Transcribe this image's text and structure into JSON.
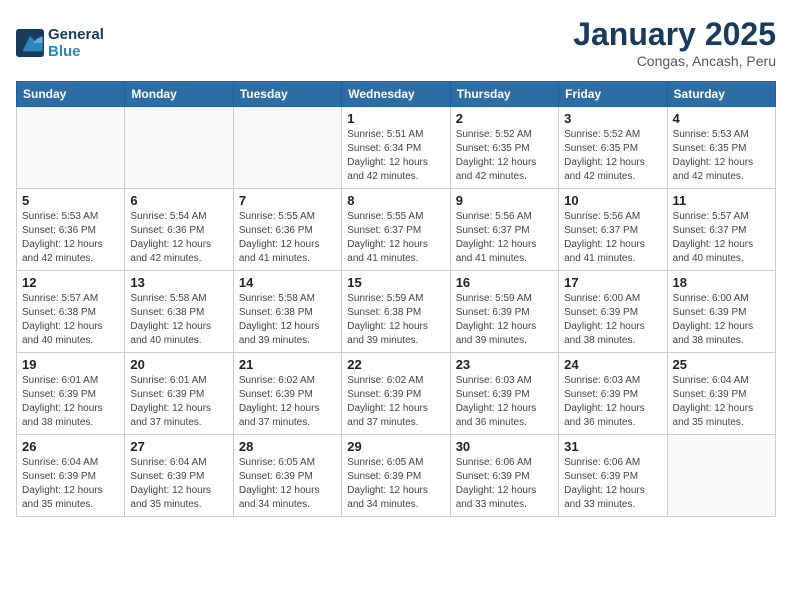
{
  "header": {
    "logo_line1": "General",
    "logo_line2": "Blue",
    "title": "January 2025",
    "subtitle": "Congas, Ancash, Peru"
  },
  "weekdays": [
    "Sunday",
    "Monday",
    "Tuesday",
    "Wednesday",
    "Thursday",
    "Friday",
    "Saturday"
  ],
  "weeks": [
    [
      {
        "day": "",
        "info": ""
      },
      {
        "day": "",
        "info": ""
      },
      {
        "day": "",
        "info": ""
      },
      {
        "day": "1",
        "info": "Sunrise: 5:51 AM\nSunset: 6:34 PM\nDaylight: 12 hours\nand 42 minutes."
      },
      {
        "day": "2",
        "info": "Sunrise: 5:52 AM\nSunset: 6:35 PM\nDaylight: 12 hours\nand 42 minutes."
      },
      {
        "day": "3",
        "info": "Sunrise: 5:52 AM\nSunset: 6:35 PM\nDaylight: 12 hours\nand 42 minutes."
      },
      {
        "day": "4",
        "info": "Sunrise: 5:53 AM\nSunset: 6:35 PM\nDaylight: 12 hours\nand 42 minutes."
      }
    ],
    [
      {
        "day": "5",
        "info": "Sunrise: 5:53 AM\nSunset: 6:36 PM\nDaylight: 12 hours\nand 42 minutes."
      },
      {
        "day": "6",
        "info": "Sunrise: 5:54 AM\nSunset: 6:36 PM\nDaylight: 12 hours\nand 42 minutes."
      },
      {
        "day": "7",
        "info": "Sunrise: 5:55 AM\nSunset: 6:36 PM\nDaylight: 12 hours\nand 41 minutes."
      },
      {
        "day": "8",
        "info": "Sunrise: 5:55 AM\nSunset: 6:37 PM\nDaylight: 12 hours\nand 41 minutes."
      },
      {
        "day": "9",
        "info": "Sunrise: 5:56 AM\nSunset: 6:37 PM\nDaylight: 12 hours\nand 41 minutes."
      },
      {
        "day": "10",
        "info": "Sunrise: 5:56 AM\nSunset: 6:37 PM\nDaylight: 12 hours\nand 41 minutes."
      },
      {
        "day": "11",
        "info": "Sunrise: 5:57 AM\nSunset: 6:37 PM\nDaylight: 12 hours\nand 40 minutes."
      }
    ],
    [
      {
        "day": "12",
        "info": "Sunrise: 5:57 AM\nSunset: 6:38 PM\nDaylight: 12 hours\nand 40 minutes."
      },
      {
        "day": "13",
        "info": "Sunrise: 5:58 AM\nSunset: 6:38 PM\nDaylight: 12 hours\nand 40 minutes."
      },
      {
        "day": "14",
        "info": "Sunrise: 5:58 AM\nSunset: 6:38 PM\nDaylight: 12 hours\nand 39 minutes."
      },
      {
        "day": "15",
        "info": "Sunrise: 5:59 AM\nSunset: 6:38 PM\nDaylight: 12 hours\nand 39 minutes."
      },
      {
        "day": "16",
        "info": "Sunrise: 5:59 AM\nSunset: 6:39 PM\nDaylight: 12 hours\nand 39 minutes."
      },
      {
        "day": "17",
        "info": "Sunrise: 6:00 AM\nSunset: 6:39 PM\nDaylight: 12 hours\nand 38 minutes."
      },
      {
        "day": "18",
        "info": "Sunrise: 6:00 AM\nSunset: 6:39 PM\nDaylight: 12 hours\nand 38 minutes."
      }
    ],
    [
      {
        "day": "19",
        "info": "Sunrise: 6:01 AM\nSunset: 6:39 PM\nDaylight: 12 hours\nand 38 minutes."
      },
      {
        "day": "20",
        "info": "Sunrise: 6:01 AM\nSunset: 6:39 PM\nDaylight: 12 hours\nand 37 minutes."
      },
      {
        "day": "21",
        "info": "Sunrise: 6:02 AM\nSunset: 6:39 PM\nDaylight: 12 hours\nand 37 minutes."
      },
      {
        "day": "22",
        "info": "Sunrise: 6:02 AM\nSunset: 6:39 PM\nDaylight: 12 hours\nand 37 minutes."
      },
      {
        "day": "23",
        "info": "Sunrise: 6:03 AM\nSunset: 6:39 PM\nDaylight: 12 hours\nand 36 minutes."
      },
      {
        "day": "24",
        "info": "Sunrise: 6:03 AM\nSunset: 6:39 PM\nDaylight: 12 hours\nand 36 minutes."
      },
      {
        "day": "25",
        "info": "Sunrise: 6:04 AM\nSunset: 6:39 PM\nDaylight: 12 hours\nand 35 minutes."
      }
    ],
    [
      {
        "day": "26",
        "info": "Sunrise: 6:04 AM\nSunset: 6:39 PM\nDaylight: 12 hours\nand 35 minutes."
      },
      {
        "day": "27",
        "info": "Sunrise: 6:04 AM\nSunset: 6:39 PM\nDaylight: 12 hours\nand 35 minutes."
      },
      {
        "day": "28",
        "info": "Sunrise: 6:05 AM\nSunset: 6:39 PM\nDaylight: 12 hours\nand 34 minutes."
      },
      {
        "day": "29",
        "info": "Sunrise: 6:05 AM\nSunset: 6:39 PM\nDaylight: 12 hours\nand 34 minutes."
      },
      {
        "day": "30",
        "info": "Sunrise: 6:06 AM\nSunset: 6:39 PM\nDaylight: 12 hours\nand 33 minutes."
      },
      {
        "day": "31",
        "info": "Sunrise: 6:06 AM\nSunset: 6:39 PM\nDaylight: 12 hours\nand 33 minutes."
      },
      {
        "day": "",
        "info": ""
      }
    ]
  ]
}
